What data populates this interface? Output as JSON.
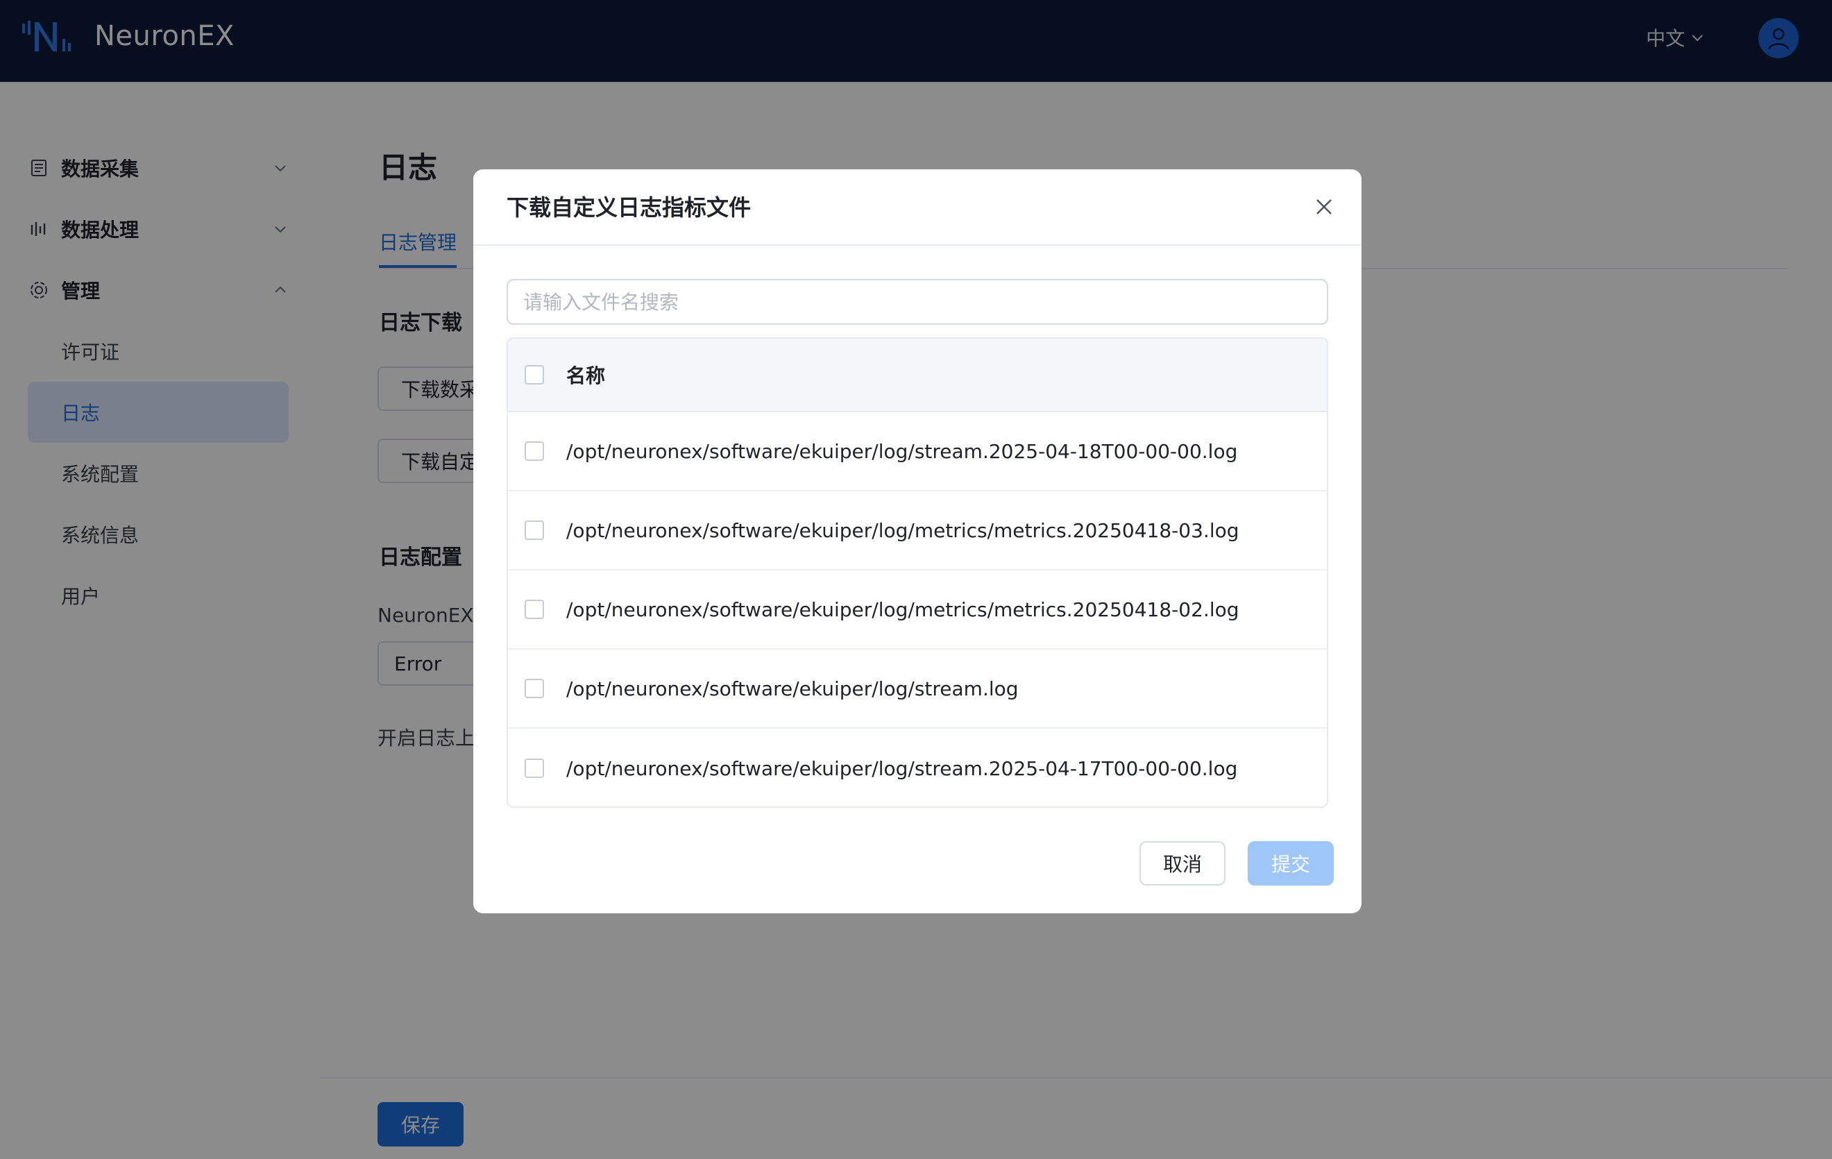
{
  "app": {
    "name": "NeuronEX"
  },
  "header": {
    "language": "中文",
    "icons": {
      "language_chevron": "chevron-down-icon",
      "user": "user-avatar-icon"
    }
  },
  "sidebar": {
    "groups": [
      {
        "label": "数据采集",
        "icon": "data-collection-icon",
        "expanded": false
      },
      {
        "label": "数据处理",
        "icon": "data-processing-icon",
        "expanded": false
      },
      {
        "label": "管理",
        "icon": "gear-icon",
        "expanded": true
      }
    ],
    "items": [
      {
        "label": "许可证"
      },
      {
        "label": "日志",
        "active": true
      },
      {
        "label": "系统配置"
      },
      {
        "label": "系统信息"
      },
      {
        "label": "用户"
      }
    ]
  },
  "main": {
    "title": "日志",
    "tab": "日志管理",
    "download_section": "日志下载",
    "download_data_btn": "下载数采",
    "download_custom_btn": "下载自定",
    "config_section": "日志配置",
    "neuronex_label": "NeuronEX",
    "level_value": "Error",
    "upload_label": "开启日志上",
    "save_btn": "保存"
  },
  "modal": {
    "title": "下载自定义日志指标文件",
    "search_placeholder": "请输入文件名搜索",
    "column_name": "名称",
    "files": [
      "/opt/neuronex/software/ekuiper/log/stream.2025-04-18T00-00-00.log",
      "/opt/neuronex/software/ekuiper/log/metrics/metrics.20250418-03.log",
      "/opt/neuronex/software/ekuiper/log/metrics/metrics.20250418-02.log",
      "/opt/neuronex/software/ekuiper/log/stream.log",
      "/opt/neuronex/software/ekuiper/log/stream.2025-04-17T00-00-00.log"
    ],
    "cancel_btn": "取消",
    "submit_btn": "提交"
  },
  "colors": {
    "primary": "#1e6fd9",
    "topbar": "#0b1b3a",
    "submit_disabled": "#9ec6f7",
    "active_bg": "#dceafd"
  }
}
